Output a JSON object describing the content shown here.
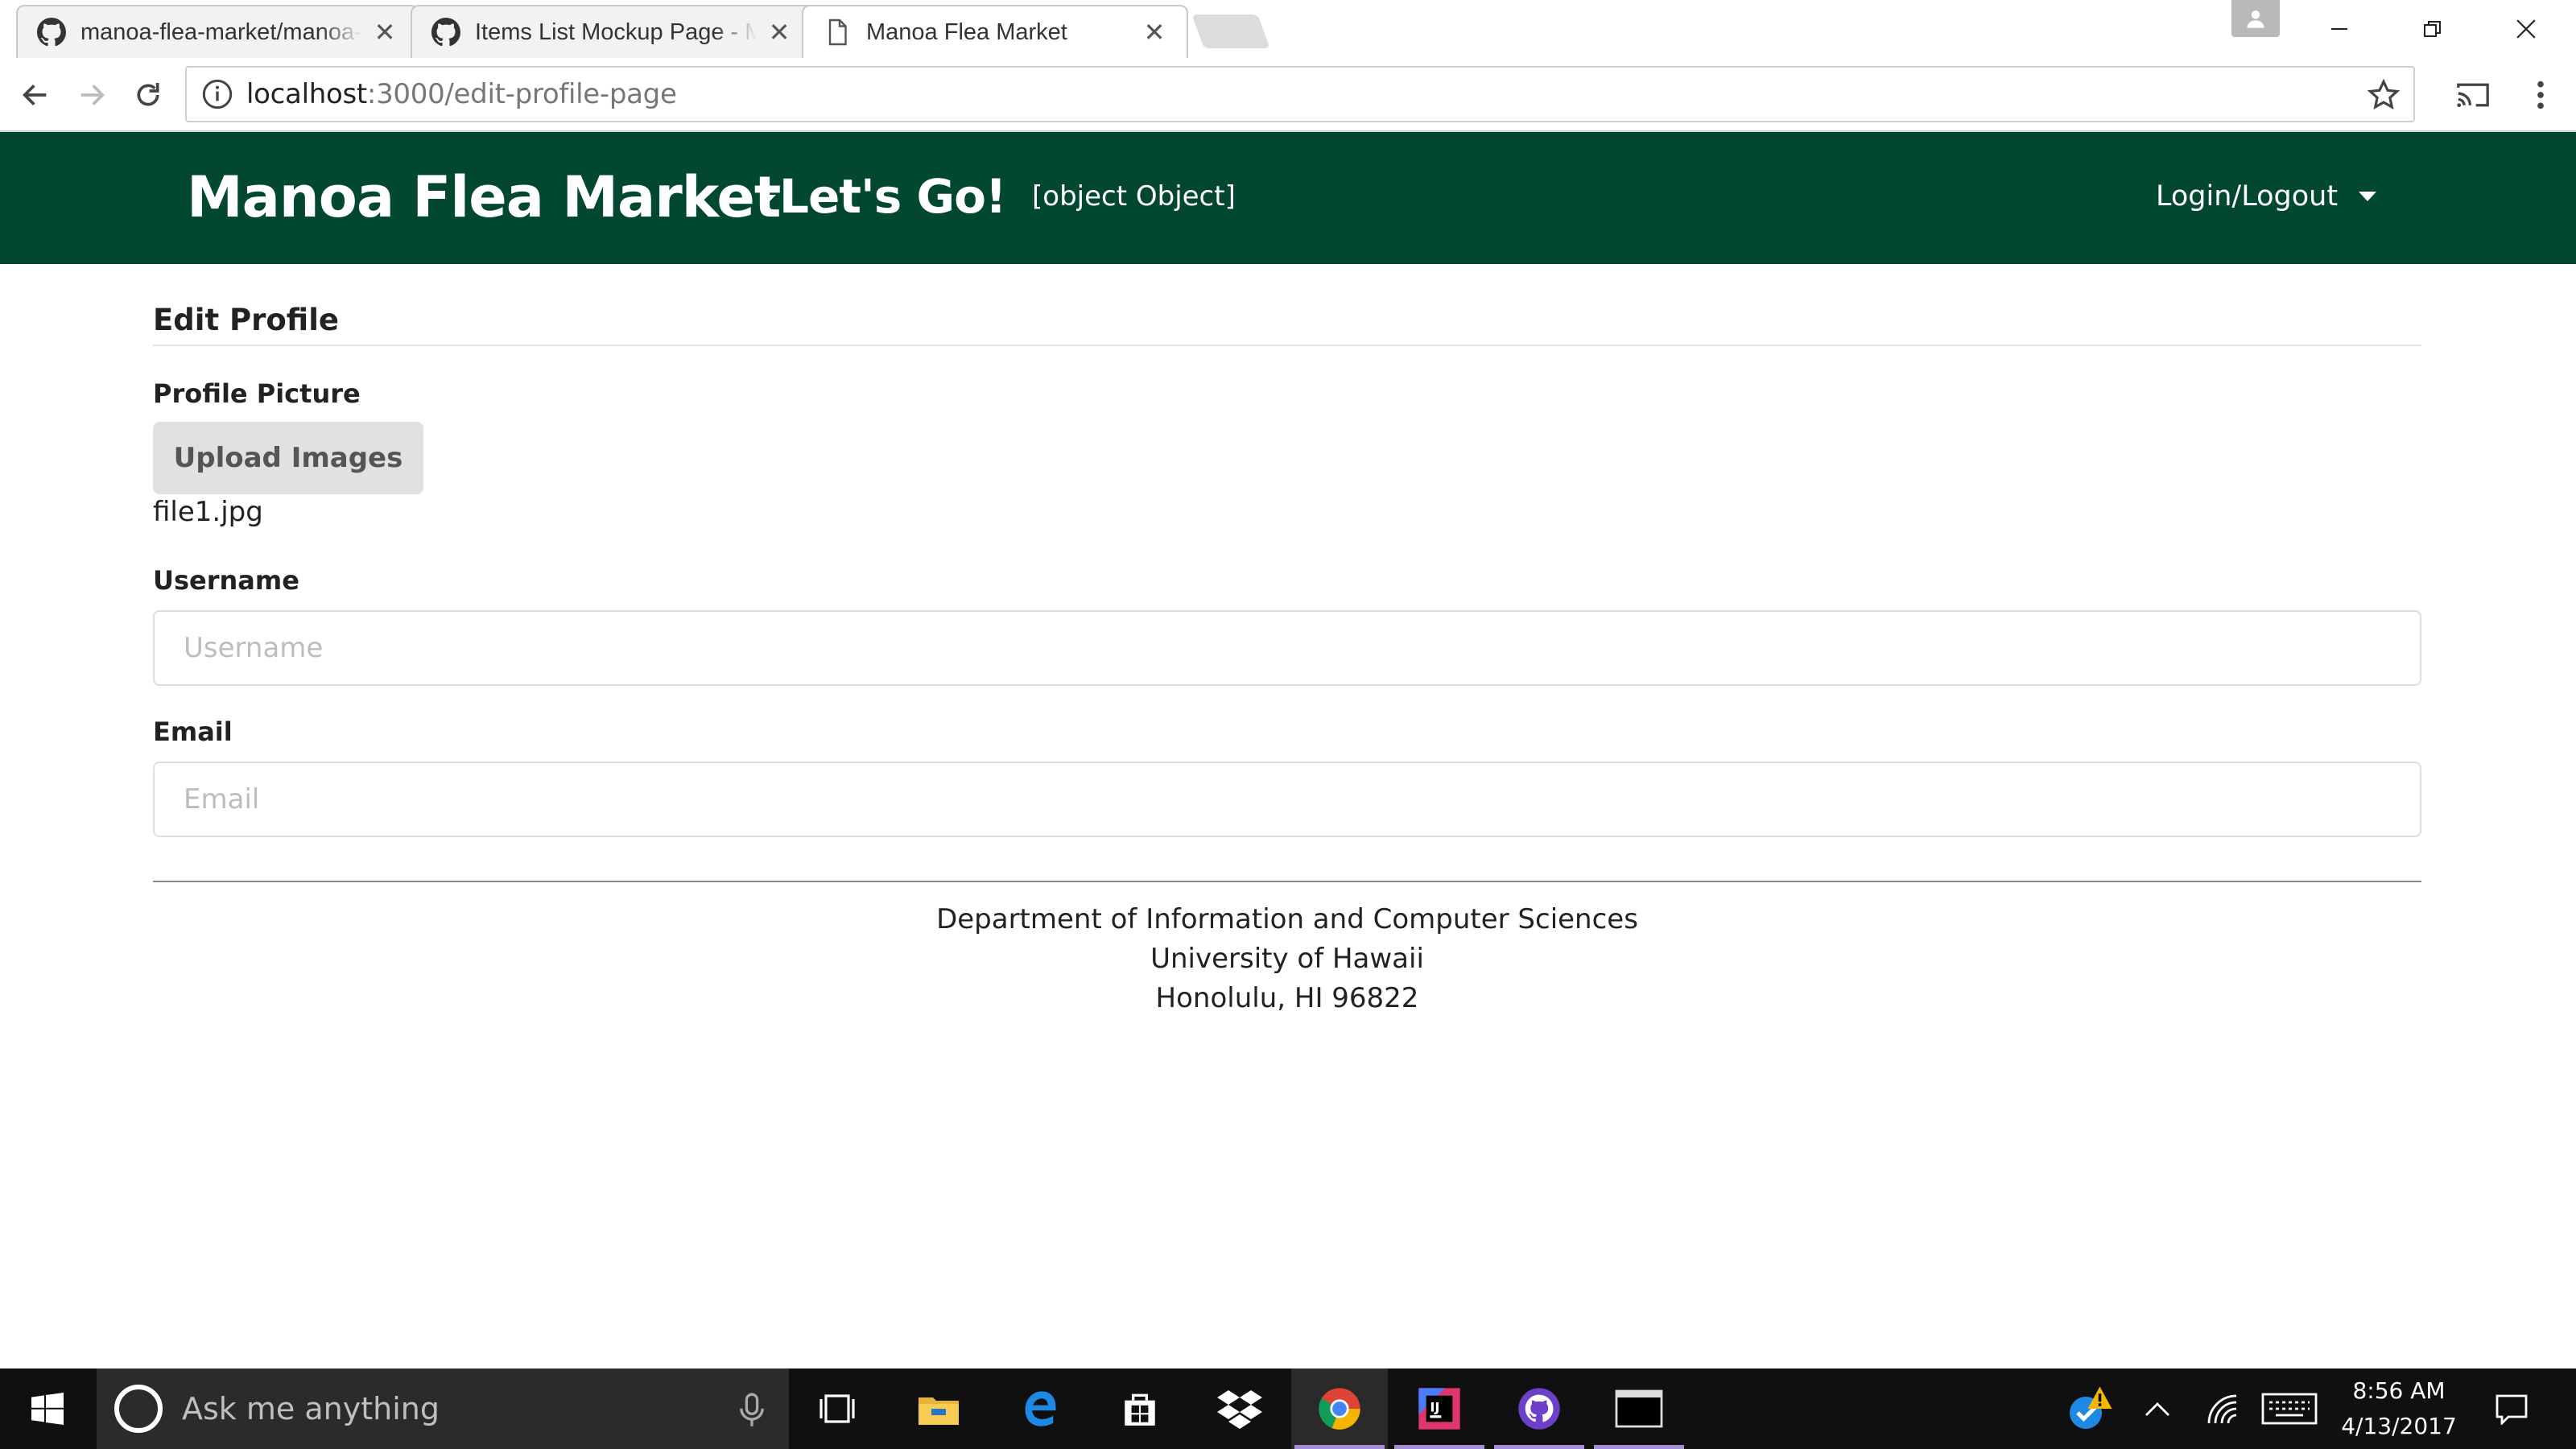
{
  "browser": {
    "tabs": [
      {
        "title": "manoa-flea-market/manoa-flea-market",
        "icon": "github-icon",
        "active": false
      },
      {
        "title": "Items List Mockup Page - Manoa Flea Market",
        "icon": "github-icon",
        "active": false
      },
      {
        "title": "Manoa Flea Market",
        "icon": "page-icon",
        "active": true
      }
    ],
    "address": {
      "host": "localhost",
      "path": ":3000/edit-profile-page"
    }
  },
  "navbar": {
    "brand": "Manoa Flea Market",
    "dropdown_label": "Let's Go!",
    "object_text": "[object Object]",
    "login_label": "Login/Logout",
    "background_color": "#024731"
  },
  "form": {
    "title": "Edit Profile",
    "profile_picture": {
      "label": "Profile Picture",
      "button_label": "Upload Images",
      "file_name": "file1.jpg"
    },
    "username": {
      "label": "Username",
      "value": "",
      "placeholder": "Username"
    },
    "email": {
      "label": "Email",
      "value": "",
      "placeholder": "Email"
    }
  },
  "footer": {
    "line1": "Department of Information and Computer Sciences",
    "line2": "University of Hawaii",
    "line3": "Honolulu, HI 96822"
  },
  "taskbar": {
    "search_placeholder": "Ask me anything",
    "time": "8:56 AM",
    "date": "4/13/2017",
    "apps": [
      "task-view-icon",
      "file-explorer-icon",
      "edge-icon",
      "store-icon",
      "dropbox-icon",
      "chrome-icon",
      "intellij-icon",
      "github-desktop-icon",
      "terminal-icon"
    ]
  }
}
